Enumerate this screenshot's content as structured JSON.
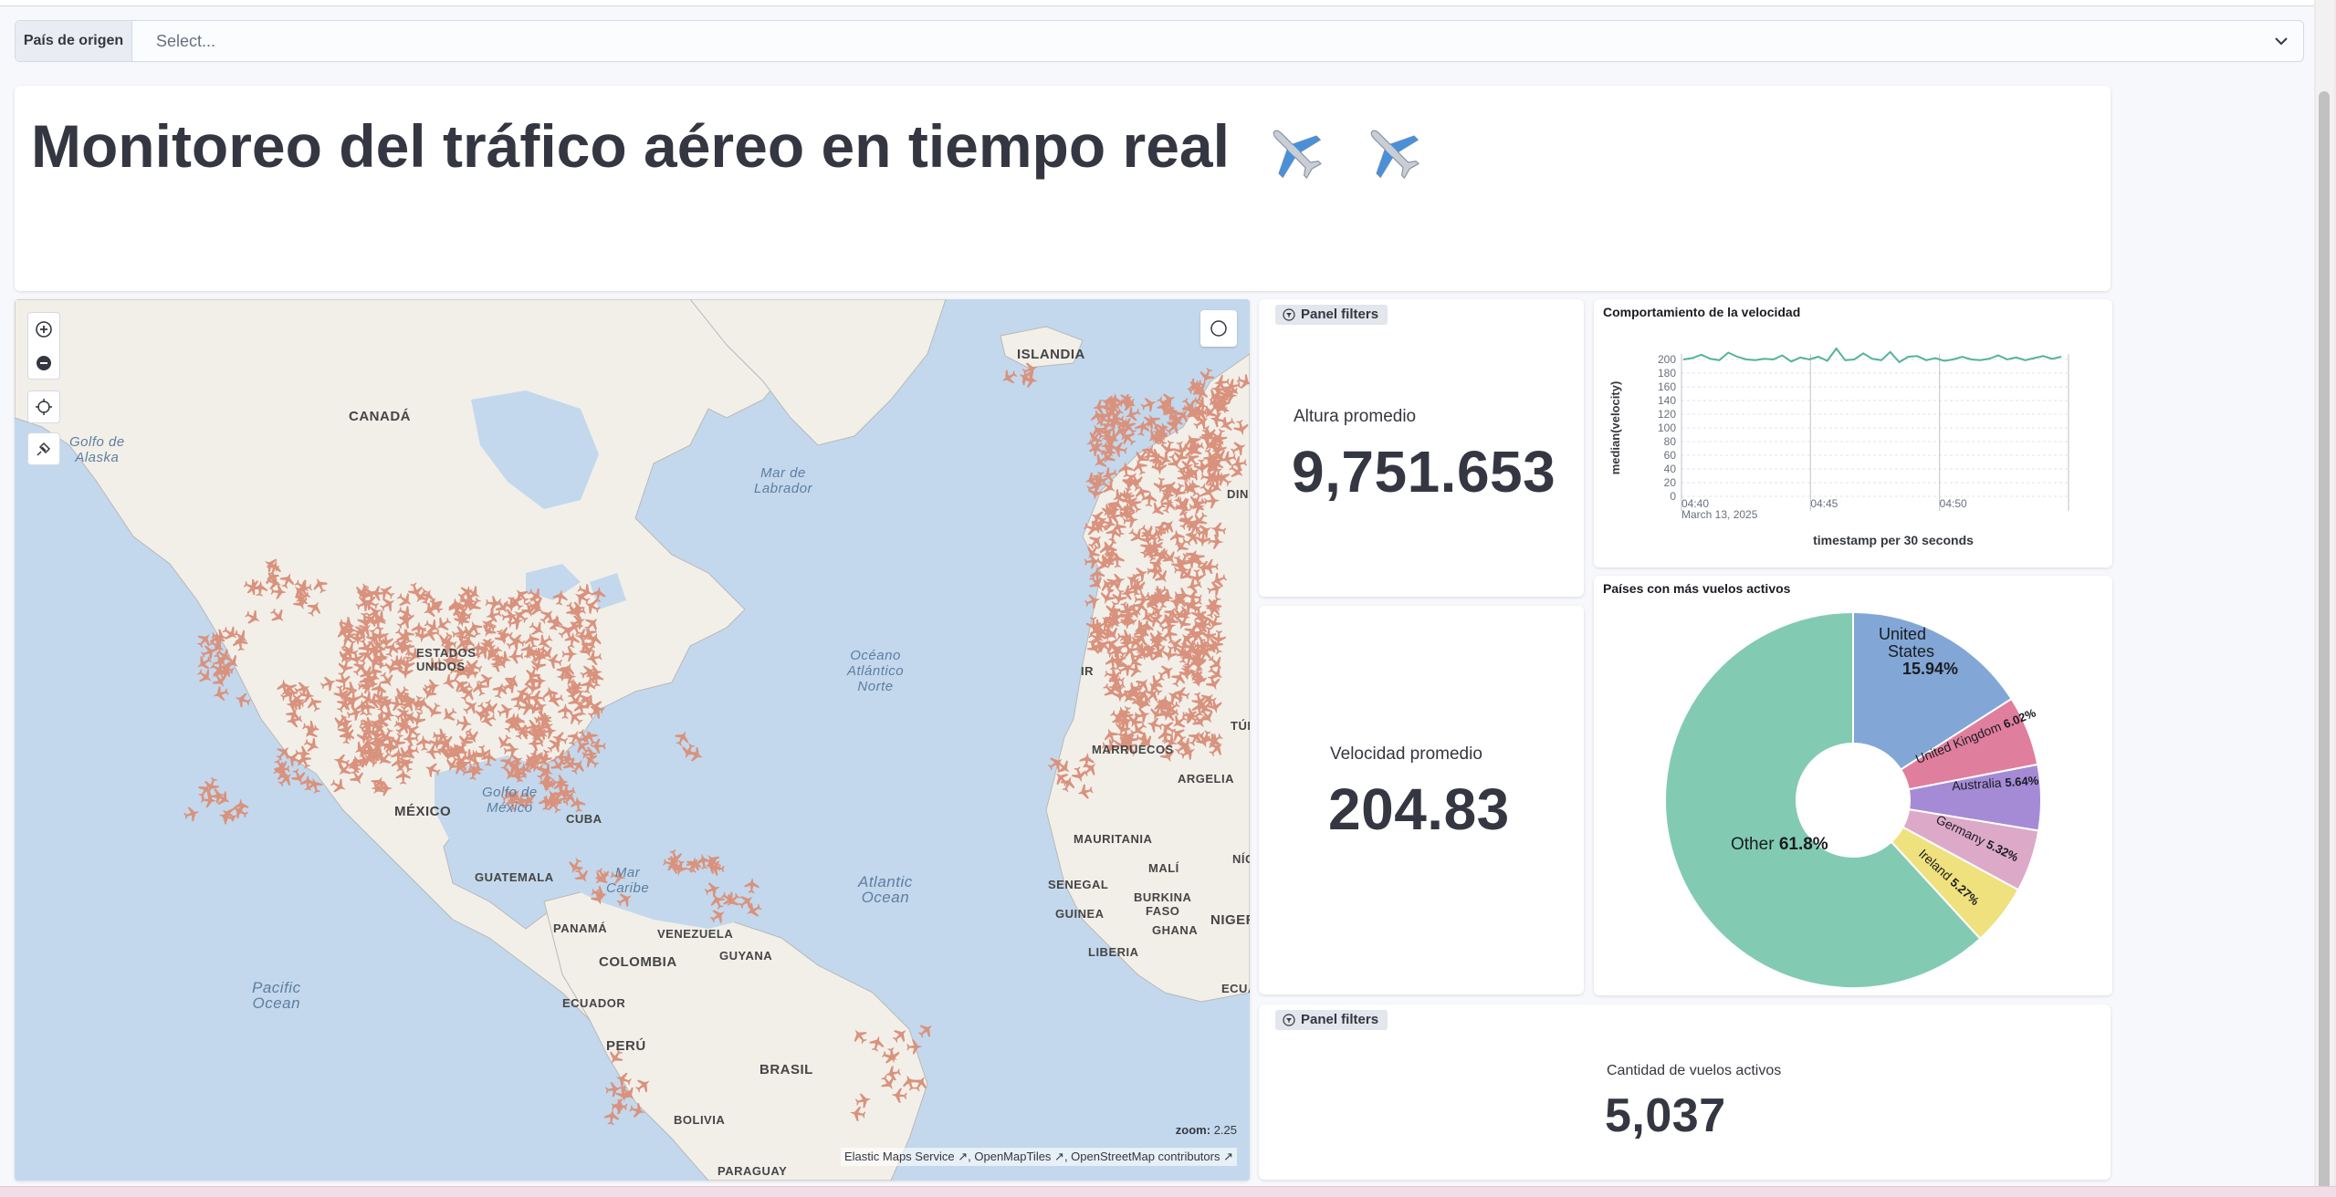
{
  "filter": {
    "label": "País de origen",
    "placeholder": "Select..."
  },
  "title": {
    "text": "Monitoreo del tráfico aéreo en tiempo real"
  },
  "map": {
    "labels": {
      "canada": "CANADÁ",
      "golfo_alaska": "Golfo de\nAlaska",
      "islandia": "ISLANDIA",
      "mar_labrador": "Mar de\nLabrador",
      "oceano_atlantico_norte": "Océano\nAtlántico\nNorte",
      "estados": "ESTADOS\nUNIDOS",
      "mexico": "MÉXICO",
      "golfo_mexico": "Golfo de\nMéxico",
      "cuba": "CUBA",
      "guatemala": "GUATEMALA",
      "mar_caribe": "Mar\nCaribe",
      "panama": "PANAMÁ",
      "venezuela": "VENEZUELA",
      "guyana": "GUYANA",
      "colombia": "COLOMBIA",
      "ecuador": "ECUADOR",
      "peru": "PERÚ",
      "brasil": "BRASIL",
      "bolivia": "BOLIVIA",
      "paraguay": "PARAGUAY",
      "pacific_ocean": "Pacific\nOcean",
      "atlantic_ocean": "Atlantic\nOcean",
      "marruecos": "MARRUECOS",
      "argelia": "ARGELIA",
      "mauritania": "MAURITANIA",
      "mali": "MALÍ",
      "niger": "NÍG",
      "senegal": "SENEGAL",
      "burkina": "BURKINA\nFASO",
      "guinea": "GUINEA",
      "ghana": "GHANA",
      "liberia": "LIBERIA",
      "nigeria": "NIGER",
      "ecua": "ECUA",
      "tur": "TÚR",
      "irlanda": "IR",
      "din": "DIN"
    },
    "zoom_label": "zoom:",
    "zoom_value": "2.25",
    "attribution": [
      "Elastic Maps Service",
      "OpenMapTiles",
      "OpenStreetMap contributors"
    ],
    "icons": {
      "zoom_in": "plus-icon",
      "zoom_out": "minus-icon",
      "fit": "crosshair-icon",
      "draw": "draw-icon",
      "layers": "layers-icon",
      "flight": "airplane-icon"
    }
  },
  "altura": {
    "badge": "Panel filters",
    "label": "Altura promedio",
    "value": "9,751.653"
  },
  "velocidad": {
    "label": "Velocidad promedio",
    "value": "204.83"
  },
  "cantidad": {
    "badge": "Panel filters",
    "label": "Cantidad de vuelos activos",
    "value": "5,037"
  },
  "speed_chart": {
    "title": "Comportamiento de la velocidad",
    "chart_data": {
      "type": "line",
      "ylabel": "median(velocity)",
      "xlabel": "timestamp per 30 seconds",
      "ylim": [
        0,
        200
      ],
      "yticks": [
        "200",
        "180",
        "160",
        "140",
        "120",
        "100",
        "80",
        "60",
        "40",
        "20",
        "0"
      ],
      "xticks": [
        "04:40",
        "04:45",
        "04:50"
      ],
      "date_label": "March 13, 2025",
      "series": [
        {
          "values": [
            200,
            202,
            207,
            201,
            199,
            210,
            204,
            200,
            199,
            201,
            200,
            206,
            197,
            203,
            200,
            204,
            198,
            216,
            199,
            200,
            209,
            201,
            199,
            211,
            196,
            204,
            205,
            199,
            202,
            198,
            200,
            204,
            200,
            199,
            201,
            206,
            200,
            203,
            199,
            202,
            205,
            201,
            204
          ]
        }
      ]
    }
  },
  "countries_chart": {
    "title": "Países con más vuelos activos",
    "chart_data": {
      "type": "pie",
      "slices": [
        {
          "label": "United States",
          "pct_label": "15.94%",
          "value": 15.94,
          "color": "#82a7d6"
        },
        {
          "label": "United Kingdom",
          "pct_label": "6.02%",
          "value": 6.02,
          "color": "#e07e9e"
        },
        {
          "label": "Australia",
          "pct_label": "5.64%",
          "value": 5.64,
          "color": "#a58bd6"
        },
        {
          "label": "Germany",
          "pct_label": "5.32%",
          "value": 5.32,
          "color": "#dda9c8"
        },
        {
          "label": "Ireland",
          "pct_label": "5.27%",
          "value": 5.27,
          "color": "#efe17e"
        },
        {
          "label": "Other",
          "pct_label": "61.8%",
          "value": 61.8,
          "color": "#82cbb2"
        }
      ]
    }
  },
  "colors": {
    "flights": "#d9927d",
    "land": "#f2efe9",
    "water": "#c3d8ec",
    "line": "#54b399"
  }
}
